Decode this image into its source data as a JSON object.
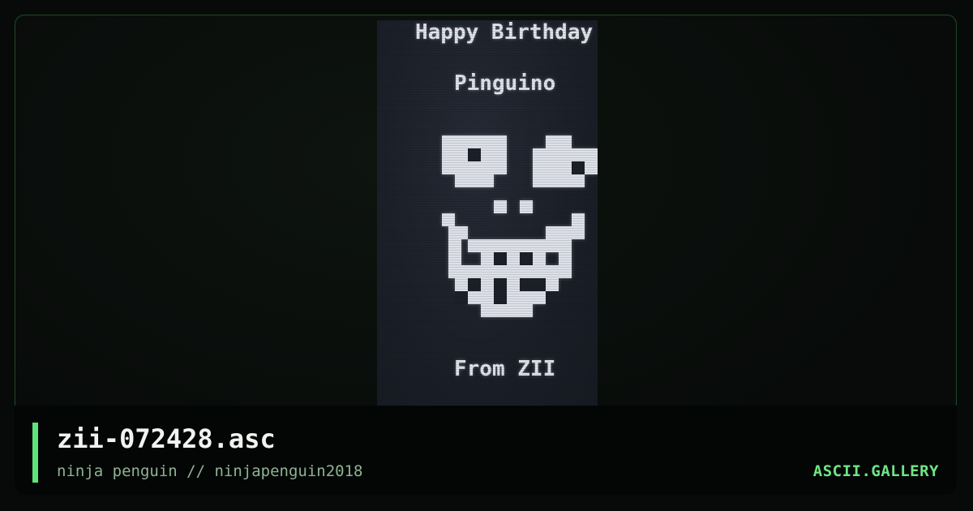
{
  "art": {
    "line_1": "Happy Birthday",
    "line_2": "Pinguino",
    "line_3": "From ZII"
  },
  "footer": {
    "file_name": "zii-072428.asc",
    "byline": "ninja penguin // ninjapenguin2018",
    "brand": "ASCII.GALLERY"
  },
  "colors": {
    "accent": "#5fe37a",
    "brand": "#6fe585",
    "art_foreground": "#e2e4ec",
    "art_background": "#1c2029"
  },
  "icons": {
    "face": "pixel-face-icon"
  }
}
